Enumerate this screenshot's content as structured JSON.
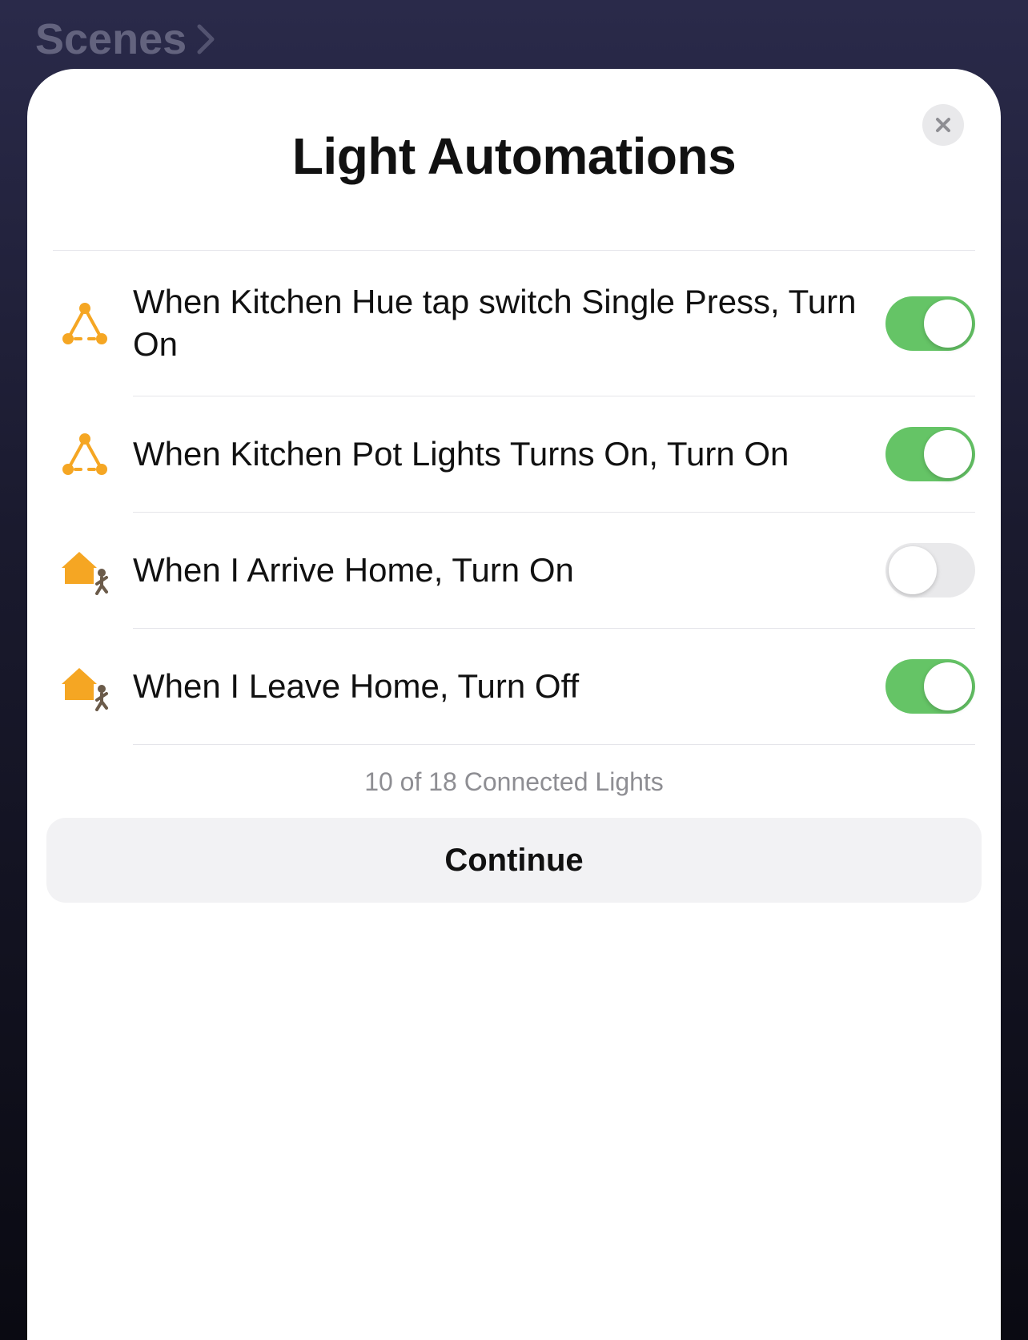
{
  "nav": {
    "title": "Scenes"
  },
  "sheet": {
    "title": "Light Automations"
  },
  "rows": [
    {
      "icon": "automation",
      "label": "When Kitchen Hue tap switch Single Press, Turn On",
      "on": true
    },
    {
      "icon": "automation",
      "label": "When Kitchen Pot Lights Turns On, Turn On",
      "on": true
    },
    {
      "icon": "home-person",
      "label": "When I Arrive Home, Turn On",
      "on": false
    },
    {
      "icon": "home-person",
      "label": "When I Leave Home, Turn Off",
      "on": true
    }
  ],
  "footer": {
    "status": "10 of 18 Connected Lights",
    "continue": "Continue"
  }
}
